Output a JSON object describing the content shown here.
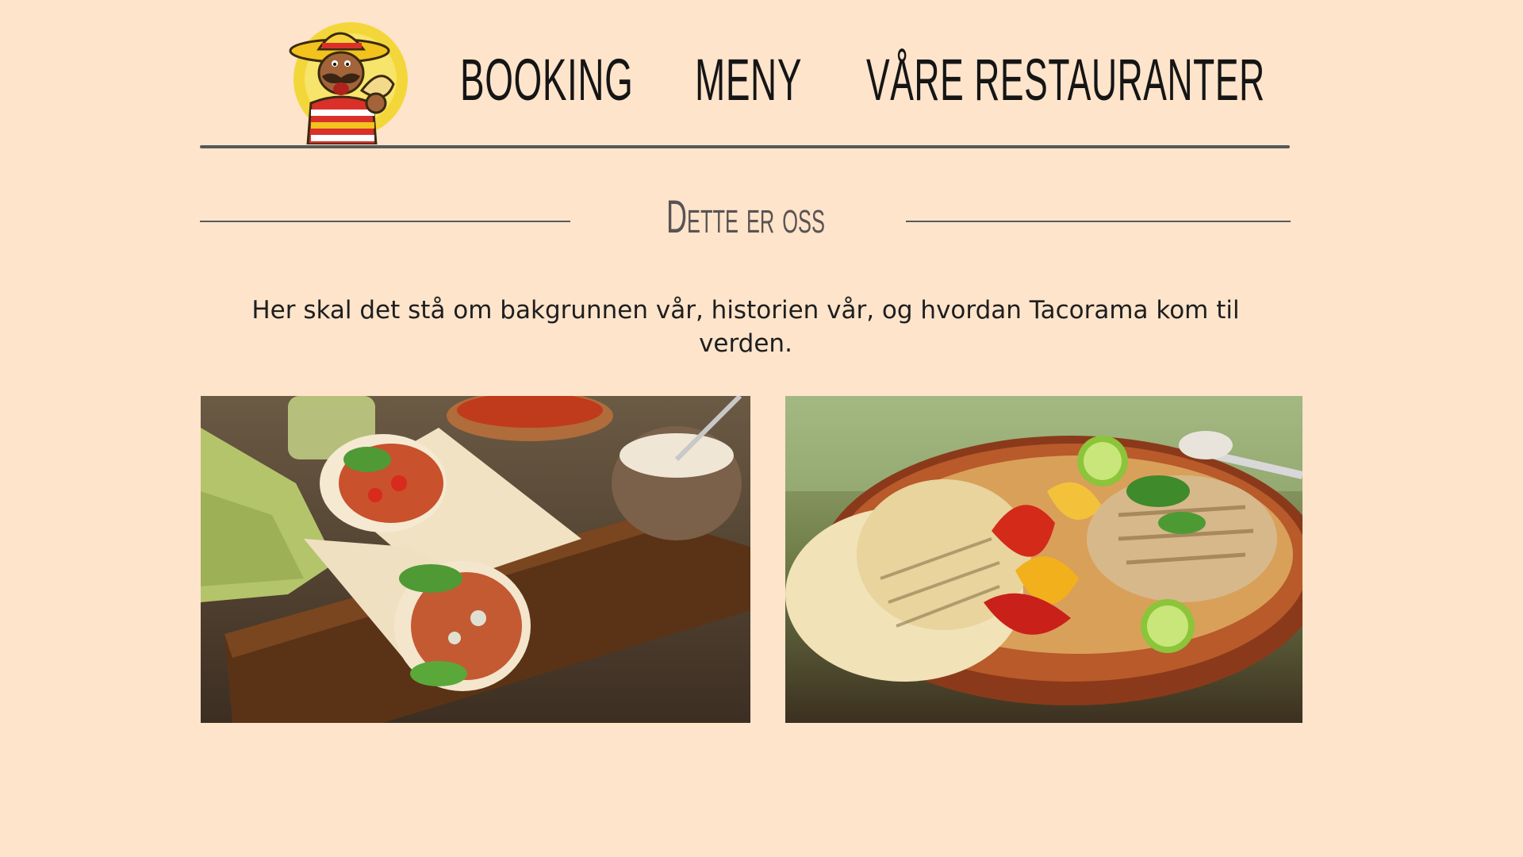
{
  "header": {
    "logo_icon": "taco-mascot-logo",
    "nav": {
      "booking": "BOOKING",
      "meny": "MENY",
      "restauranter": "VÅRE RESTAURANTER"
    }
  },
  "section": {
    "title": "Dette er oss",
    "intro": "Her skal det stå om bakgrunnen vår, historien vår, og hvordan Tacorama kom til verden."
  },
  "photos": {
    "left_icon": "burrito-wrap-photo",
    "right_icon": "fajita-platter-photo"
  },
  "colors": {
    "background": "#fde4cb",
    "rule": "#585858",
    "title": "#5a5353",
    "text": "#1e1e1e"
  }
}
